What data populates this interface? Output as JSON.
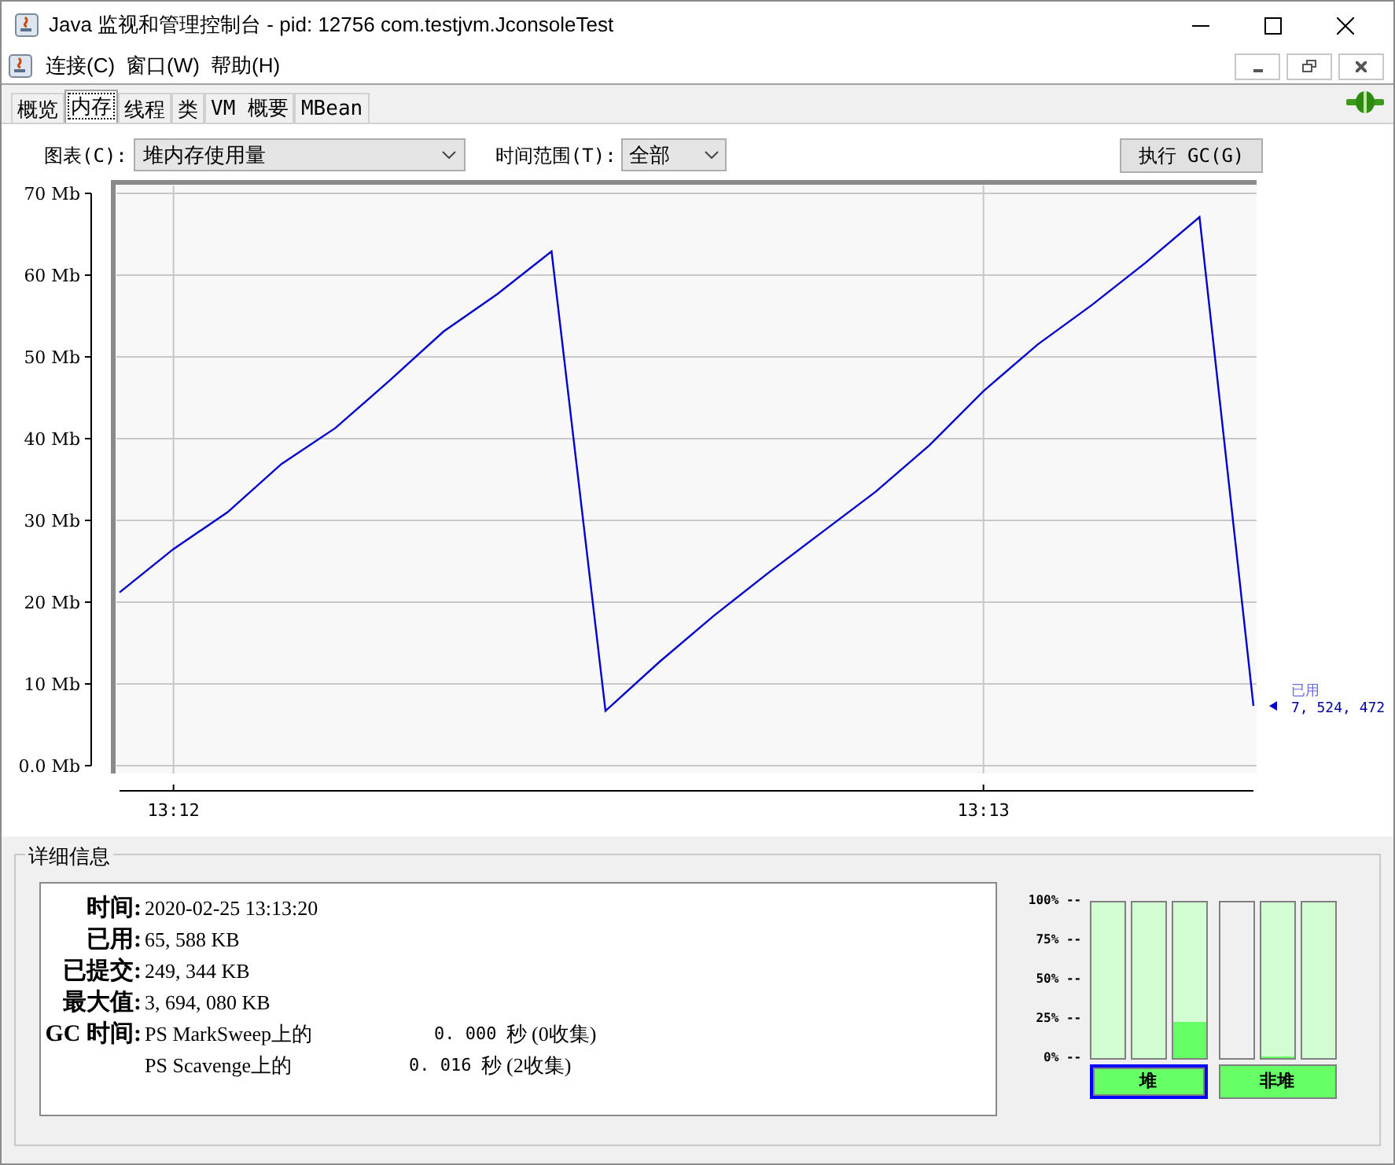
{
  "window": {
    "title": "Java 监视和管理控制台 - pid: 12756 com.testjvm.JconsoleTest"
  },
  "menu": [
    "连接(C)",
    "窗口(W)",
    "帮助(H)"
  ],
  "tabs": [
    {
      "label": "概览",
      "selected": false
    },
    {
      "label": "内存",
      "selected": true
    },
    {
      "label": "线程",
      "selected": false
    },
    {
      "label": "类",
      "selected": false
    },
    {
      "label": "VM 概要",
      "selected": false
    },
    {
      "label": "MBean",
      "selected": false
    }
  ],
  "toolbar": {
    "chart_label": "图表(C):",
    "chart_value": "堆内存使用量",
    "range_label": "时间范围(T):",
    "range_value": "全部",
    "gc_button": "执行 GC(G)"
  },
  "chart": {
    "chart_data": {
      "type": "line",
      "grid": true,
      "ylim": [
        0,
        70
      ],
      "yticks": [
        {
          "value": 0,
          "label": "0.0 Mb"
        },
        {
          "value": 10,
          "label": "10 Mb"
        },
        {
          "value": 20,
          "label": "20 Mb"
        },
        {
          "value": 30,
          "label": "30 Mb"
        },
        {
          "value": 40,
          "label": "40 Mb"
        },
        {
          "value": 50,
          "label": "50 Mb"
        },
        {
          "value": 60,
          "label": "60 Mb"
        },
        {
          "value": 70,
          "label": "70 Mb"
        }
      ],
      "categories": [
        null,
        "13:12",
        null,
        null,
        null,
        null,
        null,
        null,
        null,
        null,
        null,
        null,
        null,
        null,
        null,
        null,
        "13:13",
        null,
        null,
        null,
        null,
        null
      ],
      "series": [
        {
          "name": "已用",
          "color": "#0000cc",
          "values": [
            21.2,
            26.5,
            31.0,
            36.9,
            41.3,
            47.1,
            53.1,
            57.7,
            62.9,
            6.7,
            12.7,
            18.3,
            23.5,
            28.5,
            33.5,
            39.2,
            45.8,
            51.5,
            56.3,
            61.5,
            67.1,
            7.3
          ]
        }
      ]
    },
    "marker": {
      "value": "7, 524, 472"
    }
  },
  "details": {
    "title": "详细信息",
    "rows": [
      {
        "label": "时间:",
        "value": "2020-02-25 13:13:20"
      },
      {
        "label": "已用:",
        "value": "65, 588 KB"
      },
      {
        "label": "已提交:",
        "value": "249, 344 KB"
      },
      {
        "label": "最大值:",
        "value": "3, 694, 080 KB"
      }
    ],
    "gc_label": "GC 时间:",
    "collectors": [
      {
        "name": "PS MarkSweep上的",
        "time": "0. 000",
        "info": "秒 (0收集)"
      },
      {
        "name": "PS Scavenge上的",
        "time": "0. 016",
        "info": "秒 (2收集)"
      }
    ]
  },
  "gauges": {
    "scale": [
      "100% --",
      "75% --",
      "50% --",
      "25% --",
      "0% --"
    ],
    "groups": [
      {
        "label": "堆",
        "selected": true,
        "bars": [
          {
            "committed": true
          },
          {
            "committed": true
          },
          {
            "committed": true,
            "level": 0.23
          }
        ]
      },
      {
        "label": "非堆",
        "selected": false,
        "bars": [
          {
            "committed": false
          },
          {
            "committed": true,
            "level": 0.01
          },
          {
            "committed": true
          }
        ]
      }
    ]
  }
}
